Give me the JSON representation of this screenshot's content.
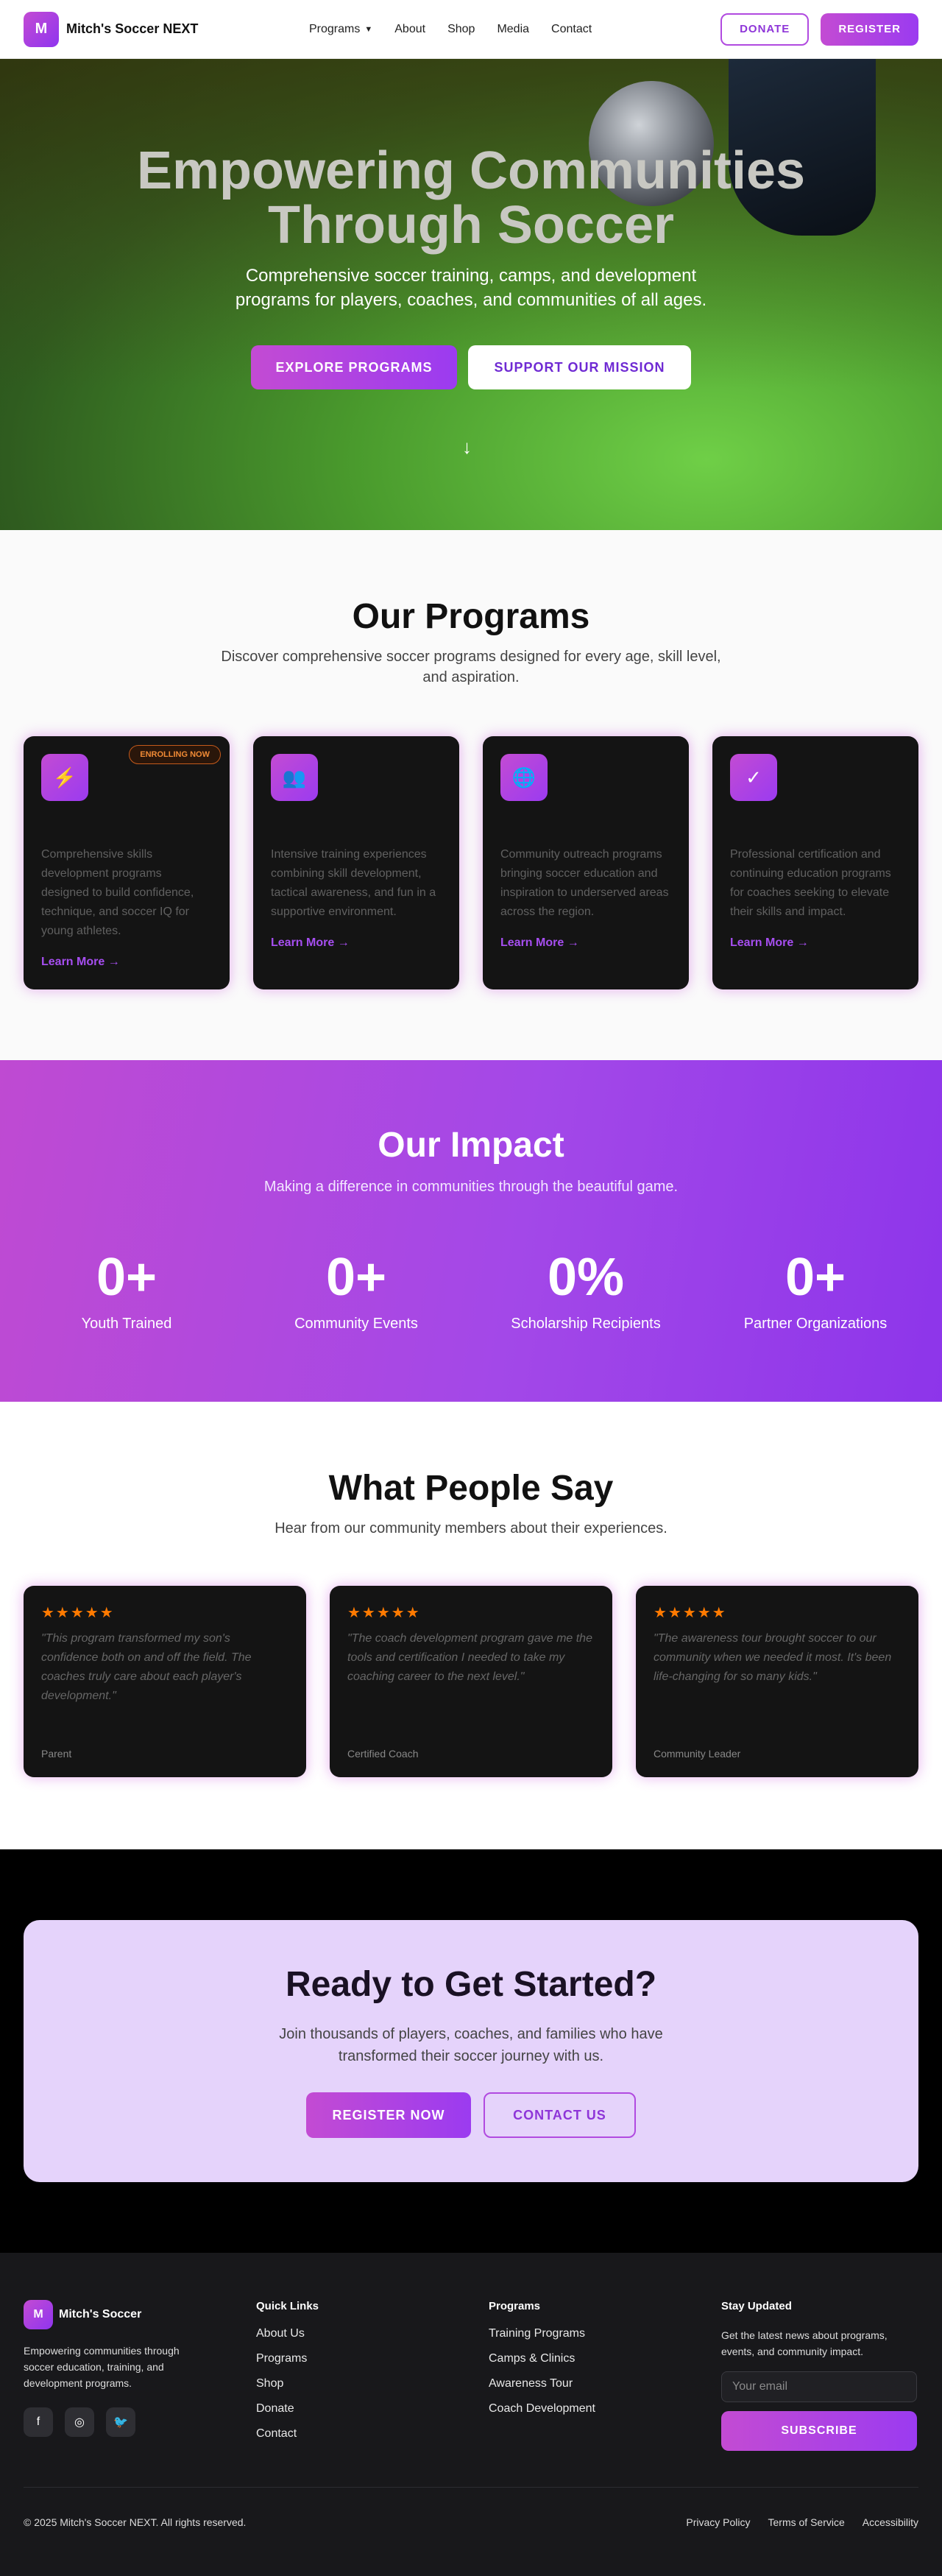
{
  "nav": {
    "logo_letter": "M",
    "brand": "Mitch's Soccer NEXT",
    "links": [
      "Programs",
      "About",
      "Shop",
      "Media",
      "Contact"
    ],
    "donate": "DONATE",
    "register": "REGISTER"
  },
  "hero": {
    "title_line1": "Empowering Communities",
    "title_line2": "Through Soccer",
    "subtitle": "Comprehensive soccer training, camps, and development programs for players, coaches, and communities of all ages.",
    "btn_primary": "EXPLORE PROGRAMS",
    "btn_secondary": "SUPPORT OUR MISSION",
    "scroll_arrow": "↓"
  },
  "programs": {
    "title": "Our Programs",
    "subtitle": "Discover comprehensive soccer programs designed for every age, skill level, and aspiration.",
    "badge": "ENROLLING NOW",
    "learn_more": "Learn More →",
    "cards": [
      {
        "icon": "lightning-icon",
        "glyph": "⚡",
        "desc": "Comprehensive skills development programs designed to build confidence, technique, and soccer IQ for young athletes."
      },
      {
        "icon": "group-icon",
        "glyph": "👥",
        "desc": "Intensive training experiences combining skill development, tactical awareness, and fun in a supportive environment."
      },
      {
        "icon": "globe-icon",
        "glyph": "🌐",
        "desc": "Community outreach programs bringing soccer education and inspiration to underserved areas across the region."
      },
      {
        "icon": "check-circle-icon",
        "glyph": "✓",
        "desc": "Professional certification and continuing education programs for coaches seeking to elevate their skills and impact."
      }
    ]
  },
  "impact": {
    "title": "Our Impact",
    "subtitle": "Making a difference in communities through the beautiful game.",
    "stats": [
      {
        "num": "0+",
        "label": "Youth Trained"
      },
      {
        "num": "0+",
        "label": "Community Events"
      },
      {
        "num": "0%",
        "label": "Scholarship Recipients"
      },
      {
        "num": "0+",
        "label": "Partner Organizations"
      }
    ]
  },
  "testimonials": {
    "title": "What People Say",
    "subtitle": "Hear from our community members about their experiences.",
    "stars": "★★★★★",
    "items": [
      {
        "quote": "\"This program transformed my son's confidence both on and off the field. The coaches truly care about each player's development.\"",
        "who": "Parent"
      },
      {
        "quote": "\"The coach development program gave me the tools and certification I needed to take my coaching career to the next level.\"",
        "who": "Certified Coach"
      },
      {
        "quote": "\"The awareness tour brought soccer to our community when we needed it most. It's been life-changing for so many kids.\"",
        "who": "Community Leader"
      }
    ]
  },
  "cta": {
    "title": "Ready to Get Started?",
    "subtitle": "Join thousands of players, coaches, and families who have transformed their soccer journey with us.",
    "register": "REGISTER NOW",
    "contact": "CONTACT US"
  },
  "footer": {
    "brand": "Mitch's Soccer",
    "logo_letter": "M",
    "desc": "Empowering communities through soccer education, training, and development programs.",
    "quick_title": "Quick Links",
    "quick_links": [
      "About Us",
      "Programs",
      "Shop",
      "Donate",
      "Contact"
    ],
    "programs_title": "Programs",
    "program_links": [
      "Training Programs",
      "Camps & Clinics",
      "Awareness Tour",
      "Coach Development"
    ],
    "news_title": "Stay Updated",
    "news_desc": "Get the latest news about programs, events, and community impact.",
    "email_placeholder": "Your email",
    "subscribe": "SUBSCRIBE",
    "copyright": "© 2025 Mitch's Soccer NEXT. All rights reserved.",
    "legal": [
      "Privacy Policy",
      "Terms of Service",
      "Accessibility"
    ]
  }
}
